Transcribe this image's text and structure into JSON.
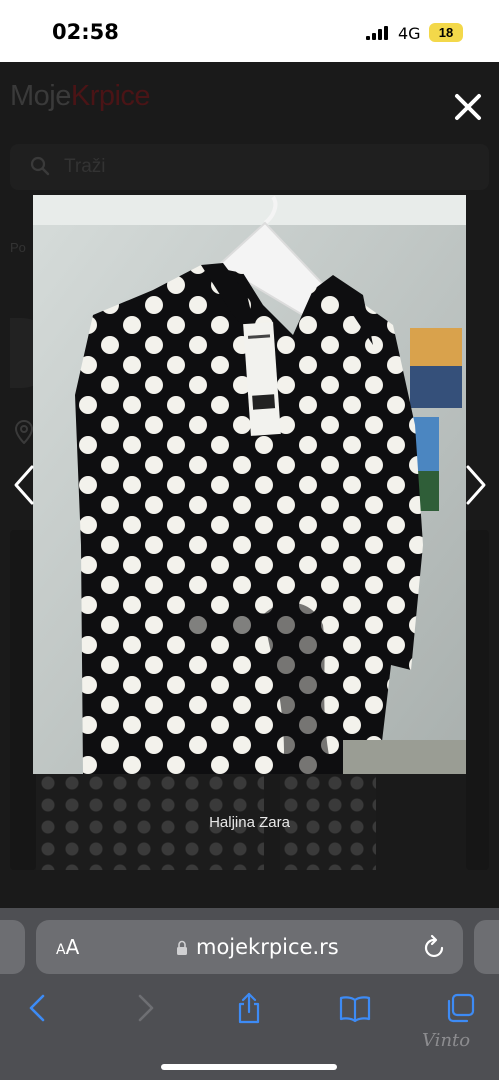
{
  "status_bar": {
    "time": "02:58",
    "network": "4G",
    "battery": "18",
    "icons": [
      "cellular-signal-icon"
    ]
  },
  "background_page": {
    "logo_part1": "Moje",
    "logo_part2": "Krpice",
    "search_placeholder": "Traži",
    "partial_label": "Po"
  },
  "lightbox": {
    "caption": "Haljina Zara",
    "image_description": "black-and-white-polka-dot-wrap-dress-on-hanger",
    "icons": [
      "close-icon",
      "chevron-left-icon",
      "chevron-right-icon"
    ]
  },
  "browser": {
    "text_size_label": "AA",
    "url": "mojekrpice.rs",
    "icons": [
      "lock-icon",
      "reload-icon",
      "back-icon",
      "forward-icon",
      "share-icon",
      "bookmarks-icon",
      "tabs-icon"
    ]
  },
  "watermark": "Vinto",
  "colors": {
    "accent_blue": "#3d8bf5",
    "battery": "#f3d84a",
    "logo_dark_red": "#4a1416",
    "browser_chrome": "#4e4f53"
  }
}
